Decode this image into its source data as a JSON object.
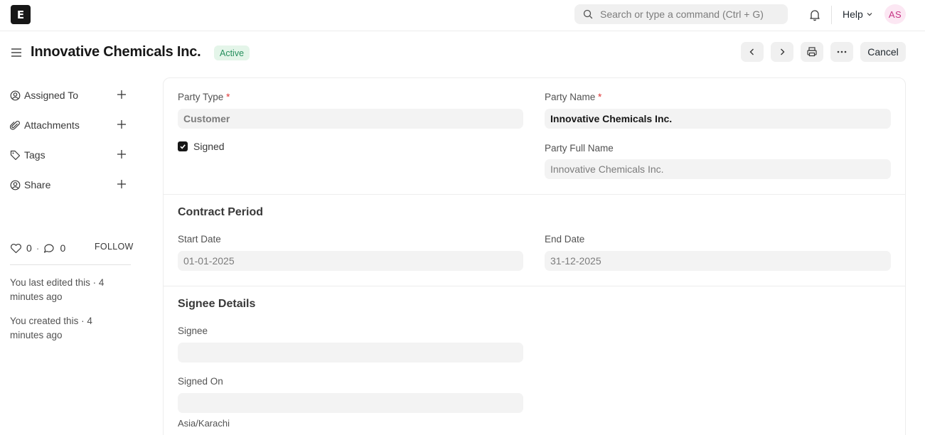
{
  "navbar": {
    "logo_letter": "E",
    "search_placeholder": "Search or type a command (Ctrl + G)",
    "help_label": "Help",
    "avatar_initials": "AS"
  },
  "page": {
    "title": "Innovative Chemicals Inc.",
    "status": "Active",
    "cancel_label": "Cancel"
  },
  "sidebar": {
    "items": [
      {
        "label": "Assigned To",
        "icon": "assign-icon"
      },
      {
        "label": "Attachments",
        "icon": "paperclip-icon"
      },
      {
        "label": "Tags",
        "icon": "tag-icon"
      },
      {
        "label": "Share",
        "icon": "share-icon"
      }
    ],
    "likes": "0",
    "comments": "0",
    "separator": "·",
    "follow_label": "FOLLOW",
    "activity": [
      "You last edited this · 4 minutes ago",
      "You created this · 4 minutes ago"
    ]
  },
  "form": {
    "party_type_label": "Party Type",
    "party_type_value": "Customer",
    "signed_label": "Signed",
    "signed_checked": true,
    "party_name_label": "Party Name",
    "party_name_value": "Innovative Chemicals Inc.",
    "party_full_name_label": "Party Full Name",
    "party_full_name_placeholder": "Innovative Chemicals Inc.",
    "required_mark": "*",
    "contract_period_title": "Contract Period",
    "start_date_label": "Start Date",
    "start_date_value": "01-01-2025",
    "end_date_label": "End Date",
    "end_date_value": "31-12-2025",
    "signee_details_title": "Signee Details",
    "signee_label": "Signee",
    "signee_value": "",
    "signed_on_label": "Signed On",
    "signed_on_value": "",
    "timezone": "Asia/Karachi"
  },
  "colors": {
    "status_bg": "#e4f5e9",
    "status_text": "#278f5e",
    "required": "#e03636",
    "avatar_text": "#c53484"
  }
}
